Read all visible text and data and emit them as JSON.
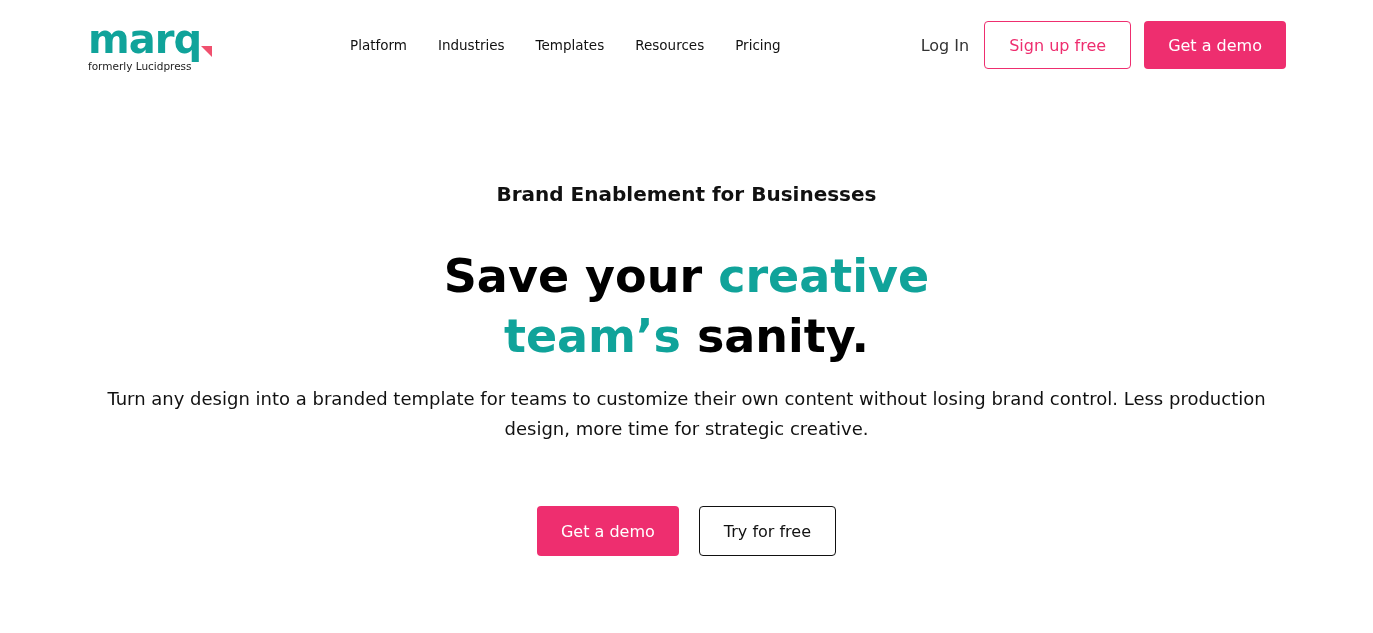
{
  "logo": {
    "wordmark": "marq",
    "tagline": "formerly Lucidpress"
  },
  "nav": [
    "Platform",
    "Industries",
    "Templates",
    "Resources",
    "Pricing"
  ],
  "header_actions": [
    {
      "label": "Log In",
      "kind": "link"
    },
    {
      "label": "Sign up free",
      "kind": "outline"
    },
    {
      "label": "Get a demo",
      "kind": "primary"
    }
  ],
  "hero": {
    "eyebrow": "Brand Enablement for Businesses",
    "headline": [
      {
        "text": "Save your ",
        "accent": false
      },
      {
        "text": "creative",
        "accent": true
      },
      {
        "text": "team’s",
        "accent": true
      },
      {
        "text": " sanity.",
        "accent": false
      }
    ],
    "body": "Turn any design into a branded template for teams to customize their own content without losing brand control. Less production design, more time for strategic creative.",
    "buttons": [
      {
        "label": "Get a demo",
        "kind": "primary"
      },
      {
        "label": "Try for free",
        "kind": "outline-dark"
      }
    ]
  }
}
